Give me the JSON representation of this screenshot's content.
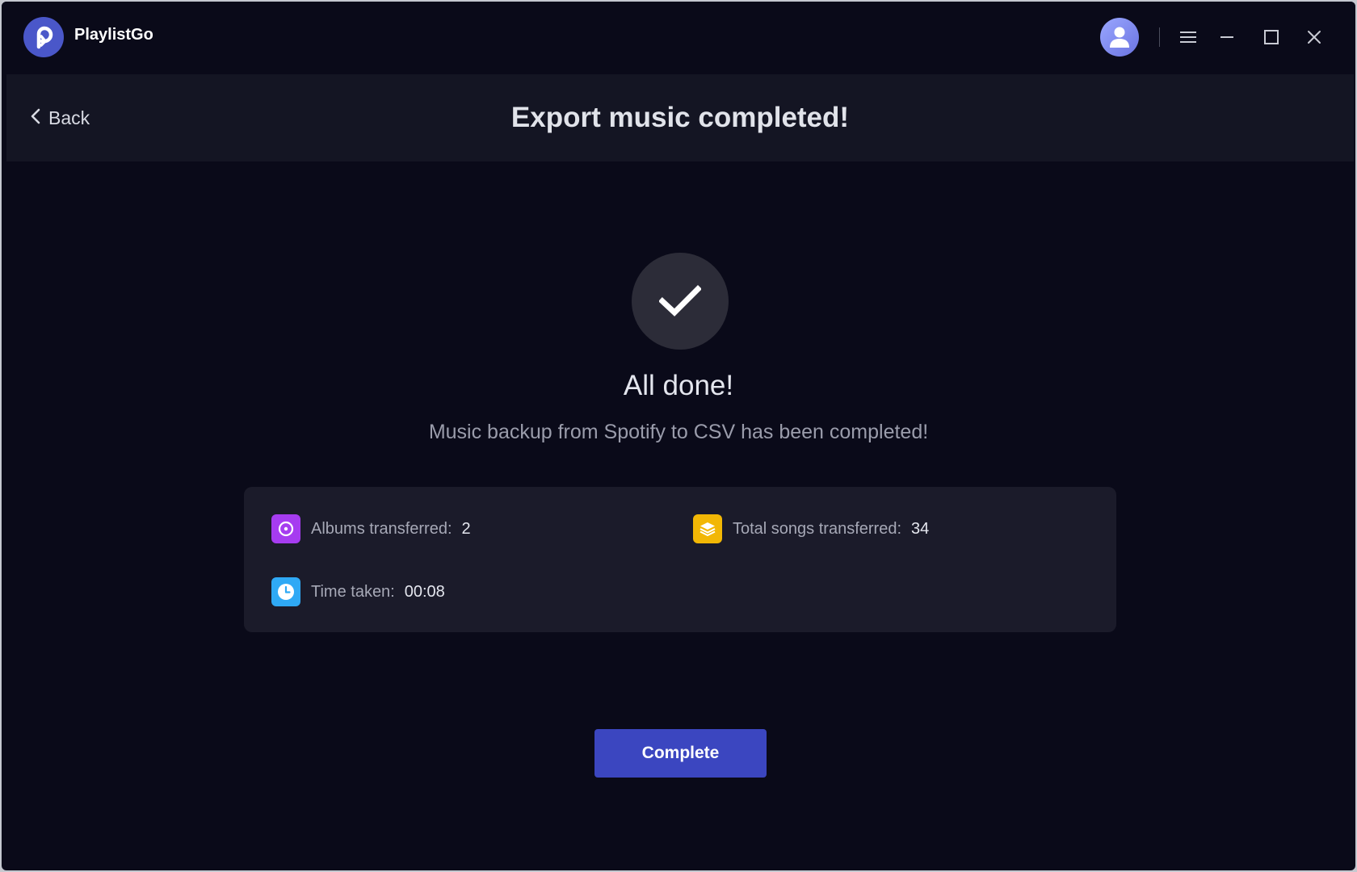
{
  "app": {
    "name": "PlaylistGo"
  },
  "titlebar": {
    "icons": [
      "user-avatar-icon",
      "menu-icon",
      "minimize-icon",
      "maximize-icon",
      "close-icon"
    ]
  },
  "header": {
    "back_label": "Back",
    "title": "Export music completed!"
  },
  "result": {
    "icon": "checkmark-icon",
    "title": "All done!",
    "subtitle": "Music backup from Spotify to CSV has been completed!"
  },
  "stats": {
    "albums": {
      "label": "Albums transferred:",
      "value": "2",
      "icon": "album-icon",
      "color": "#a63cf0"
    },
    "songs": {
      "label": "Total songs transferred:",
      "value": "34",
      "icon": "layers-icon",
      "color": "#f2b705"
    },
    "time": {
      "label": "Time taken:",
      "value": "00:08",
      "icon": "clock-icon",
      "color": "#2fa9f5"
    }
  },
  "actions": {
    "complete_label": "Complete"
  },
  "colors": {
    "background": "#0a0a19",
    "header": "#141523",
    "card": "#1b1b2a",
    "accent": "#3b46c0"
  }
}
